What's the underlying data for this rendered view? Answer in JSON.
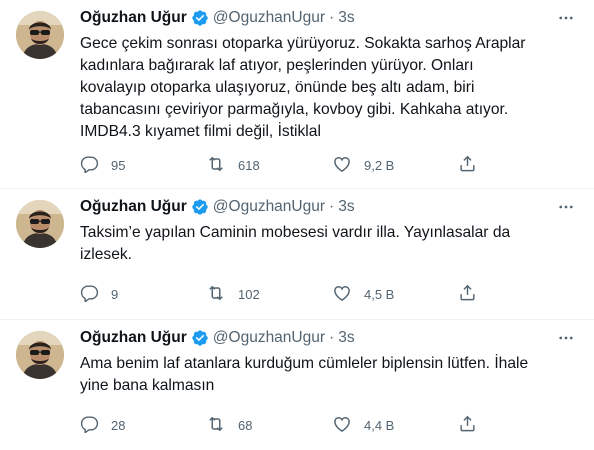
{
  "user": {
    "name": "Oğuzhan Uğur",
    "handle": "@OguzhanUgur",
    "separator": "·",
    "time": "3s"
  },
  "icons": {
    "verified": "verified-badge-icon",
    "more": "more-dots-icon",
    "reply": "reply-icon",
    "retweet": "retweet-icon",
    "like": "heart-icon",
    "share": "share-icon"
  },
  "colors": {
    "verified": "#1d9bf0",
    "secondary_text": "#536471",
    "divider": "#eff3f4"
  },
  "tweets": [
    {
      "text": "Gece çekim sonrası otoparka yürüyoruz. Sokakta sarhoş Araplar kadınlara bağırarak laf atıyor, peşlerinden yürüyor. Onları kovalayıp otoparka ulaşıyoruz, önünde beş altı adam, biri tabancasını çeviriyor parmağıyla, kovboy gibi. Kahkaha atıyor. IMDB4.3 kıyamet filmi değil, İstiklal",
      "replies": "95",
      "retweets": "618",
      "likes": "9,2 B"
    },
    {
      "text": "Taksim’e yapılan Caminin mobesesi vardır illa. Yayınlasalar da izlesek.",
      "replies": "9",
      "retweets": "102",
      "likes": "4,5 B"
    },
    {
      "text": "Ama benim laf atanlara kurduğum cümleler biplensin lütfen. İhale yine bana kalmasın",
      "replies": "28",
      "retweets": "68",
      "likes": "4,4 B"
    }
  ]
}
